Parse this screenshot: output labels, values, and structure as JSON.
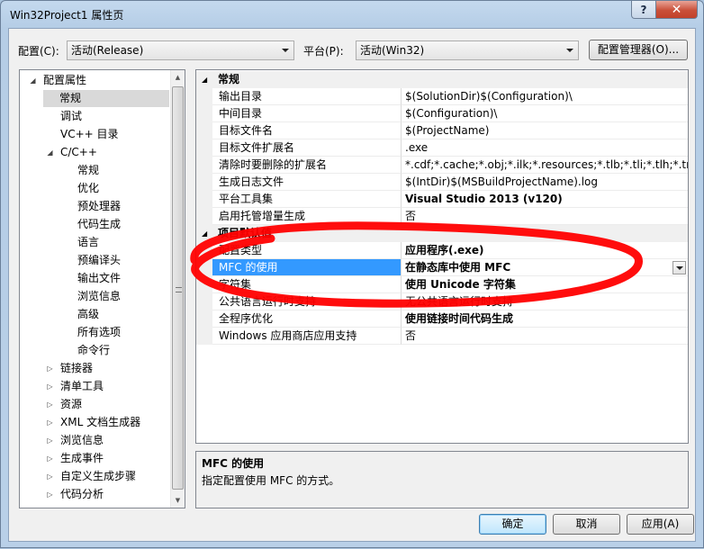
{
  "window": {
    "title": "Win32Project1 属性页",
    "help_label": "?",
    "close_label": "✕"
  },
  "toolbar": {
    "config_label": "配置(C):",
    "config_value": "活动(Release)",
    "platform_label": "平台(P):",
    "platform_value": "活动(Win32)",
    "config_manager_label": "配置管理器(O)..."
  },
  "tree": {
    "items": [
      {
        "label": "配置属性",
        "level": 0,
        "state": "expanded"
      },
      {
        "label": "常规",
        "level": 1,
        "state": "leaf",
        "selected": true
      },
      {
        "label": "调试",
        "level": 1,
        "state": "leaf"
      },
      {
        "label": "VC++ 目录",
        "level": 1,
        "state": "leaf"
      },
      {
        "label": "C/C++",
        "level": 1,
        "state": "expanded"
      },
      {
        "label": "常规",
        "level": 2,
        "state": "leaf"
      },
      {
        "label": "优化",
        "level": 2,
        "state": "leaf"
      },
      {
        "label": "预处理器",
        "level": 2,
        "state": "leaf"
      },
      {
        "label": "代码生成",
        "level": 2,
        "state": "leaf"
      },
      {
        "label": "语言",
        "level": 2,
        "state": "leaf"
      },
      {
        "label": "预编译头",
        "level": 2,
        "state": "leaf"
      },
      {
        "label": "输出文件",
        "level": 2,
        "state": "leaf"
      },
      {
        "label": "浏览信息",
        "level": 2,
        "state": "leaf"
      },
      {
        "label": "高级",
        "level": 2,
        "state": "leaf"
      },
      {
        "label": "所有选项",
        "level": 2,
        "state": "leaf"
      },
      {
        "label": "命令行",
        "level": 2,
        "state": "leaf"
      },
      {
        "label": "链接器",
        "level": 1,
        "state": "collapsed"
      },
      {
        "label": "清单工具",
        "level": 1,
        "state": "collapsed"
      },
      {
        "label": "资源",
        "level": 1,
        "state": "collapsed"
      },
      {
        "label": "XML 文档生成器",
        "level": 1,
        "state": "collapsed"
      },
      {
        "label": "浏览信息",
        "level": 1,
        "state": "collapsed"
      },
      {
        "label": "生成事件",
        "level": 1,
        "state": "collapsed"
      },
      {
        "label": "自定义生成步骤",
        "level": 1,
        "state": "collapsed"
      },
      {
        "label": "代码分析",
        "level": 1,
        "state": "collapsed"
      }
    ]
  },
  "grid": {
    "sections": [
      {
        "title": "常规",
        "rows": [
          {
            "name": "输出目录",
            "value": "$(SolutionDir)$(Configuration)\\",
            "bold": false
          },
          {
            "name": "中间目录",
            "value": "$(Configuration)\\",
            "bold": false
          },
          {
            "name": "目标文件名",
            "value": "$(ProjectName)",
            "bold": false
          },
          {
            "name": "目标文件扩展名",
            "value": ".exe",
            "bold": false
          },
          {
            "name": "清除时要删除的扩展名",
            "value": "*.cdf;*.cache;*.obj;*.ilk;*.resources;*.tlb;*.tli;*.tlh;*.tmp;*.rsp;",
            "bold": false
          },
          {
            "name": "生成日志文件",
            "value": "$(IntDir)$(MSBuildProjectName).log",
            "bold": false
          },
          {
            "name": "平台工具集",
            "value": "Visual Studio 2013 (v120)",
            "bold": true
          },
          {
            "name": "启用托管增量生成",
            "value": "否",
            "bold": false
          }
        ]
      },
      {
        "title": "项目默认值",
        "rows": [
          {
            "name": "配置类型",
            "value": "应用程序(.exe)",
            "bold": true
          },
          {
            "name": "MFC 的使用",
            "value": "在静态库中使用 MFC",
            "bold": true,
            "selected": true
          },
          {
            "name": "字符集",
            "value": "使用 Unicode 字符集",
            "bold": true
          },
          {
            "name": "公共语言运行时支持",
            "value": "无公共语言运行时支持",
            "bold": false
          },
          {
            "name": "全程序优化",
            "value": "使用链接时间代码生成",
            "bold": true
          },
          {
            "name": "Windows 应用商店应用支持",
            "value": "否",
            "bold": false
          }
        ]
      }
    ]
  },
  "description": {
    "title": "MFC 的使用",
    "text": "指定配置使用 MFC 的方式。"
  },
  "buttons": {
    "ok": "确定",
    "cancel": "取消",
    "apply": "应用(A)"
  },
  "colors": {
    "selection": "#3399ff",
    "annotation": "#ff0000"
  }
}
